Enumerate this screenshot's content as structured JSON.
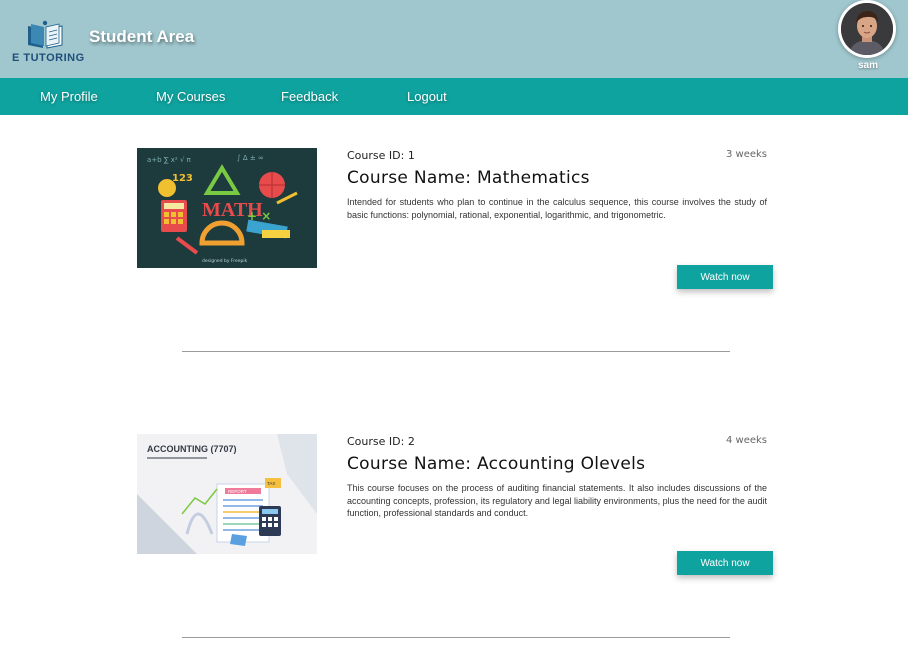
{
  "brand": {
    "logo_text": "E TUTORING",
    "title": "Student Area"
  },
  "user": {
    "name": "sam"
  },
  "nav": {
    "items": [
      {
        "label": "My Profile"
      },
      {
        "label": "My Courses"
      },
      {
        "label": "Feedback"
      },
      {
        "label": "Logout"
      }
    ]
  },
  "courses": [
    {
      "id_label": "Course ID: 1",
      "duration": "3 weeks",
      "name": "Course Name: Mathematics",
      "description": "Intended for students who plan to continue in the calculus sequence, this course involves the study of basic functions: polynomial, rational, exponential, logarithmic, and trigonometric.",
      "button": "Watch now",
      "image_text": "MATH",
      "image_credit": "designed by Freepik"
    },
    {
      "id_label": "Course ID: 2",
      "duration": "4 weeks",
      "name": "Course Name: Accounting Olevels",
      "description": "This course focuses on the process of auditing financial statements. It also includes discussions of the accounting concepts, profession, its regulatory and legal liability environments, plus the need for the audit function, professional standards and conduct.",
      "button": "Watch now",
      "image_text": "ACCOUNTING (7707)",
      "image_labels": [
        "REPORT",
        "TAX"
      ]
    }
  ],
  "colors": {
    "header_bg": "#a0c7ce",
    "nav_bg": "#0fa39f",
    "button_bg": "#0fa39f"
  }
}
